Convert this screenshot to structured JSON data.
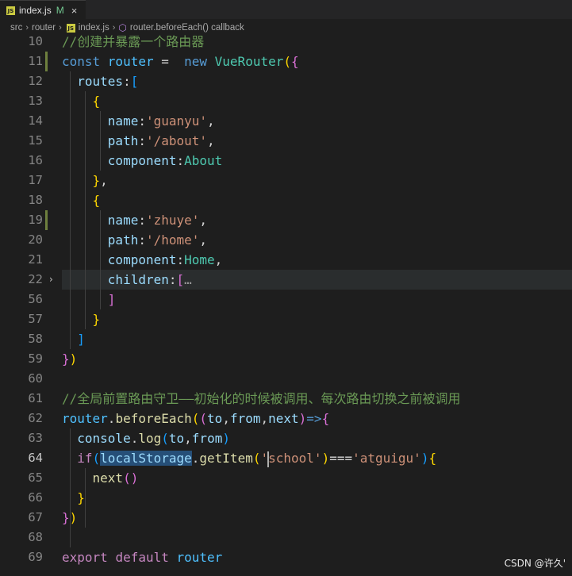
{
  "tab": {
    "filename": "index.js",
    "status": "M",
    "close": "×",
    "badge": "JS"
  },
  "breadcrumb": {
    "parts": [
      "src",
      "router",
      "index.js",
      "router.beforeEach() callback"
    ]
  },
  "watermark": "CSDN @许久'",
  "lines": [
    {
      "n": "10",
      "tokens": [
        [
          "cm",
          "//创建并暴露一个路由器"
        ]
      ]
    },
    {
      "n": "11",
      "tokens": [
        [
          "kw",
          "const "
        ],
        [
          "var",
          "router"
        ],
        [
          "pl",
          " =  "
        ],
        [
          "kw",
          "new "
        ],
        [
          "cls",
          "VueRouter"
        ],
        [
          "y1",
          "("
        ],
        [
          "p2",
          "{"
        ]
      ]
    },
    {
      "n": "12",
      "tokens": [
        [
          "pl",
          "  "
        ],
        [
          "prop",
          "routes"
        ],
        [
          "pl",
          ":"
        ],
        [
          "b3",
          "["
        ]
      ]
    },
    {
      "n": "13",
      "tokens": [
        [
          "pl",
          "    "
        ],
        [
          "y1",
          "{"
        ]
      ]
    },
    {
      "n": "14",
      "tokens": [
        [
          "pl",
          "      "
        ],
        [
          "prop",
          "name"
        ],
        [
          "pl",
          ":"
        ],
        [
          "str",
          "'guanyu'"
        ],
        [
          "pl",
          ","
        ]
      ]
    },
    {
      "n": "15",
      "tokens": [
        [
          "pl",
          "      "
        ],
        [
          "prop",
          "path"
        ],
        [
          "pl",
          ":"
        ],
        [
          "str",
          "'/about'"
        ],
        [
          "pl",
          ","
        ]
      ]
    },
    {
      "n": "16",
      "tokens": [
        [
          "pl",
          "      "
        ],
        [
          "prop",
          "component"
        ],
        [
          "pl",
          ":"
        ],
        [
          "cls",
          "About"
        ]
      ]
    },
    {
      "n": "17",
      "tokens": [
        [
          "pl",
          "    "
        ],
        [
          "y1",
          "}"
        ],
        [
          "pl",
          ","
        ]
      ]
    },
    {
      "n": "18",
      "tokens": [
        [
          "pl",
          "    "
        ],
        [
          "y1",
          "{"
        ]
      ]
    },
    {
      "n": "19",
      "tokens": [
        [
          "pl",
          "      "
        ],
        [
          "prop",
          "name"
        ],
        [
          "pl",
          ":"
        ],
        [
          "str",
          "'zhuye'"
        ],
        [
          "pl",
          ","
        ]
      ]
    },
    {
      "n": "20",
      "tokens": [
        [
          "pl",
          "      "
        ],
        [
          "prop",
          "path"
        ],
        [
          "pl",
          ":"
        ],
        [
          "str",
          "'/home'"
        ],
        [
          "pl",
          ","
        ]
      ]
    },
    {
      "n": "21",
      "tokens": [
        [
          "pl",
          "      "
        ],
        [
          "prop",
          "component"
        ],
        [
          "pl",
          ":"
        ],
        [
          "cls",
          "Home"
        ],
        [
          "pl",
          ","
        ]
      ]
    },
    {
      "n": "22",
      "tokens": [
        [
          "pl",
          "      "
        ],
        [
          "prop",
          "children"
        ],
        [
          "pl",
          ":"
        ],
        [
          "p2",
          "["
        ],
        [
          "fold-dots",
          "…"
        ]
      ]
    },
    {
      "n": "56",
      "tokens": [
        [
          "pl",
          "      "
        ],
        [
          "p2",
          "]"
        ]
      ]
    },
    {
      "n": "57",
      "tokens": [
        [
          "pl",
          "    "
        ],
        [
          "y1",
          "}"
        ]
      ]
    },
    {
      "n": "58",
      "tokens": [
        [
          "pl",
          "  "
        ],
        [
          "b3",
          "]"
        ]
      ]
    },
    {
      "n": "59",
      "tokens": [
        [
          "p2",
          "}"
        ],
        [
          "y1",
          ")"
        ]
      ]
    },
    {
      "n": "60",
      "tokens": []
    },
    {
      "n": "61",
      "tokens": [
        [
          "cm",
          "//全局前置路由守卫——初始化的时候被调用、每次路由切换之前被调用"
        ]
      ]
    },
    {
      "n": "62",
      "tokens": [
        [
          "var",
          "router"
        ],
        [
          "pl",
          "."
        ],
        [
          "fn",
          "beforeEach"
        ],
        [
          "y1",
          "("
        ],
        [
          "p2",
          "("
        ],
        [
          "prop",
          "to"
        ],
        [
          "pl",
          ","
        ],
        [
          "prop",
          "from"
        ],
        [
          "pl",
          ","
        ],
        [
          "prop",
          "next"
        ],
        [
          "p2",
          ")"
        ],
        [
          "kw",
          "=>"
        ],
        [
          "p2",
          "{"
        ]
      ]
    },
    {
      "n": "63",
      "tokens": [
        [
          "pl",
          "  "
        ],
        [
          "prop",
          "console"
        ],
        [
          "pl",
          "."
        ],
        [
          "fn",
          "log"
        ],
        [
          "b3",
          "("
        ],
        [
          "prop",
          "to"
        ],
        [
          "pl",
          ","
        ],
        [
          "prop",
          "from"
        ],
        [
          "b3",
          ")"
        ]
      ]
    },
    {
      "n": "64",
      "tokens": [
        [
          "pl",
          "  "
        ],
        [
          "ctl",
          "if"
        ],
        [
          "b3",
          "("
        ],
        [
          "prop sel",
          "localStorage"
        ],
        [
          "pl",
          "."
        ],
        [
          "fn",
          "getItem"
        ],
        [
          "y1",
          "("
        ],
        [
          "str",
          "'"
        ],
        [
          "cursor",
          ""
        ],
        [
          "str",
          "school'"
        ],
        [
          "y1",
          ")"
        ],
        [
          "pl",
          "==="
        ],
        [
          "str",
          "'atguigu'"
        ],
        [
          "b3",
          ")"
        ],
        [
          "y1",
          "{"
        ]
      ]
    },
    {
      "n": "65",
      "tokens": [
        [
          "pl",
          "    "
        ],
        [
          "fn",
          "next"
        ],
        [
          "p2",
          "()"
        ]
      ]
    },
    {
      "n": "66",
      "tokens": [
        [
          "pl",
          "  "
        ],
        [
          "y1",
          "}"
        ]
      ]
    },
    {
      "n": "67",
      "tokens": [
        [
          "p2",
          "}"
        ],
        [
          "y1",
          ")"
        ]
      ]
    },
    {
      "n": "68",
      "tokens": []
    },
    {
      "n": "69",
      "tokens": [
        [
          "ctl",
          "export "
        ],
        [
          "ctl",
          "default "
        ],
        [
          "var",
          "router"
        ]
      ]
    }
  ]
}
